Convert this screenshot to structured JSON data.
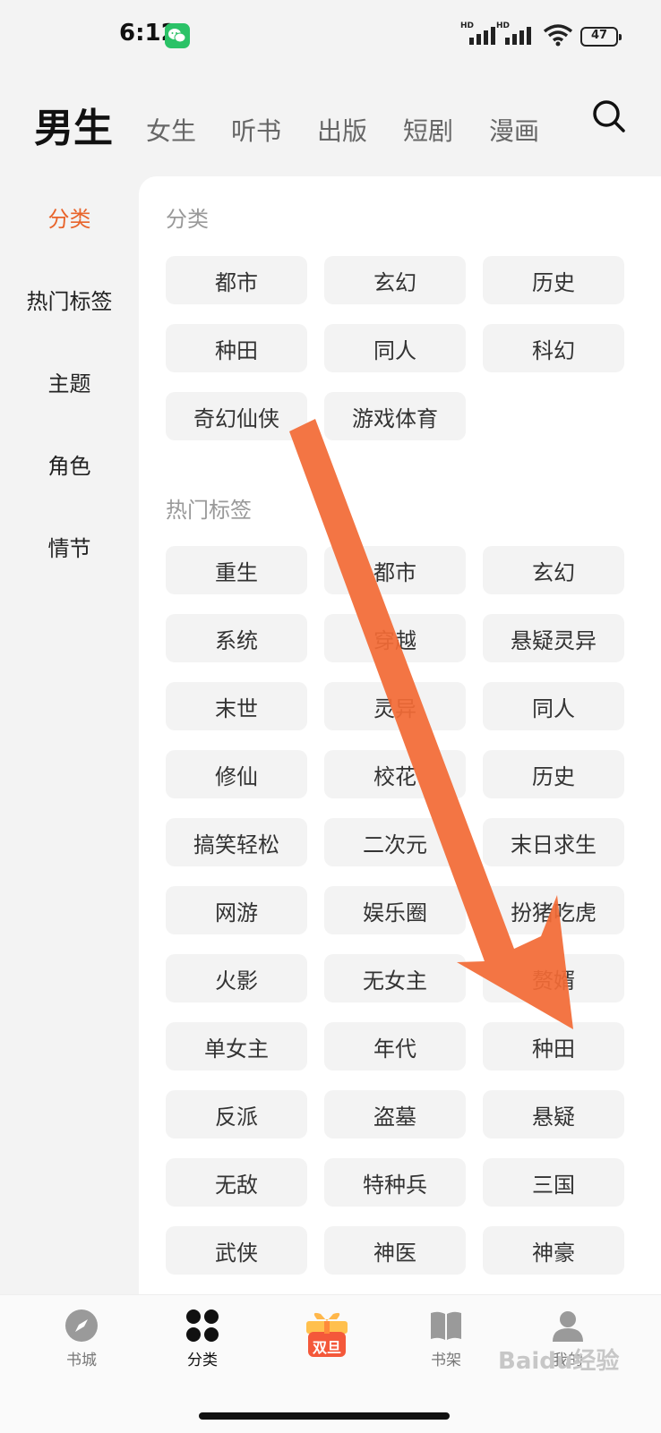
{
  "status_bar": {
    "time": "6:12",
    "signal_1_label": "HD",
    "signal_2_label": "HD",
    "battery": "47"
  },
  "top_tabs": [
    {
      "label": "男生",
      "active": true
    },
    {
      "label": "女生"
    },
    {
      "label": "听书"
    },
    {
      "label": "出版"
    },
    {
      "label": "短剧"
    },
    {
      "label": "漫画"
    }
  ],
  "side_nav": [
    {
      "label": "分类",
      "active": true
    },
    {
      "label": "热门标签"
    },
    {
      "label": "主题"
    },
    {
      "label": "角色"
    },
    {
      "label": "情节"
    }
  ],
  "sections": {
    "category": {
      "title": "分类",
      "items": [
        "都市",
        "玄幻",
        "历史",
        "种田",
        "同人",
        "科幻",
        "奇幻仙侠",
        "游戏体育"
      ]
    },
    "hot_tags": {
      "title": "热门标签",
      "items": [
        "重生",
        "都市",
        "玄幻",
        "系统",
        "穿越",
        "悬疑灵异",
        "末世",
        "灵异",
        "同人",
        "修仙",
        "校花",
        "历史",
        "搞笑轻松",
        "二次元",
        "末日求生",
        "网游",
        "娱乐圈",
        "扮猪吃虎",
        "火影",
        "无女主",
        "赘婿",
        "单女主",
        "年代",
        "种田",
        "反派",
        "盗墓",
        "悬疑",
        "无敌",
        "特种兵",
        "三国",
        "武侠",
        "神医",
        "神豪"
      ]
    }
  },
  "bottom_nav": [
    {
      "label": "书城",
      "icon": "compass-icon"
    },
    {
      "label": "分类",
      "icon": "category-grid-icon",
      "active": true
    },
    {
      "label": "双旦",
      "icon": "gift-promo-icon"
    },
    {
      "label": "书架",
      "icon": "book-icon"
    },
    {
      "label": "我的",
      "icon": "user-icon"
    }
  ],
  "promo": {
    "label": "双旦"
  },
  "watermark": "Baidu经验",
  "colors": {
    "accent": "#e8642b",
    "arrow": "#f26b36",
    "chip_bg": "#f3f3f3",
    "background": "#f3f3f3"
  }
}
